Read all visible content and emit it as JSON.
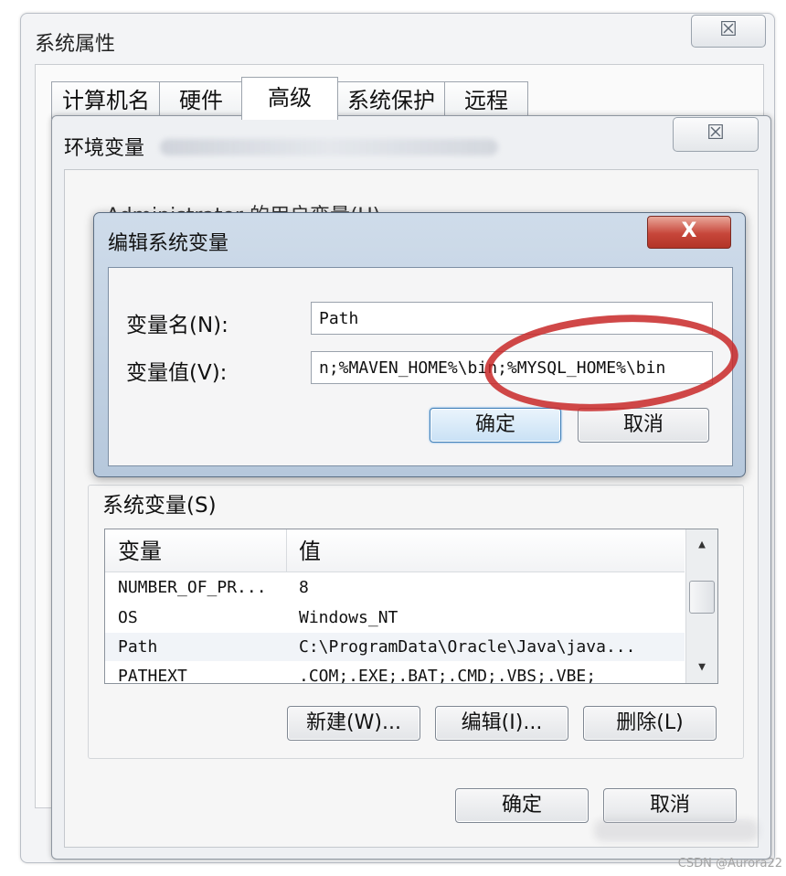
{
  "outer_window": {
    "title": "系统属性",
    "close_glyph": "☒",
    "tabs": [
      "计算机名",
      "硬件",
      "高级",
      "系统保护",
      "远程"
    ]
  },
  "env_window": {
    "title": "环境变量",
    "close_glyph": "☒",
    "user_group_caption": "Administrator 的用户变量(U)",
    "system_group_caption": "系统变量(S)",
    "columns": [
      "变量",
      "值"
    ],
    "rows": [
      {
        "name": "NUMBER_OF_PR...",
        "value": "8"
      },
      {
        "name": "OS",
        "value": "Windows_NT"
      },
      {
        "name": "Path",
        "value": "C:\\ProgramData\\Oracle\\Java\\java..."
      },
      {
        "name": "PATHEXT",
        "value": ".COM;.EXE;.BAT;.CMD;.VBS;.VBE;"
      }
    ],
    "buttons": {
      "new": "新建(W)...",
      "edit": "编辑(I)...",
      "delete": "删除(L)"
    },
    "ok": "确定",
    "cancel": "取消"
  },
  "edit_dialog": {
    "title": "编辑系统变量",
    "close_glyph": "X",
    "name_label": "变量名(N):",
    "value_label": "变量值(V):",
    "name_value": "Path",
    "value_value": "n;%MAVEN_HOME%\\bin;%MYSQL_HOME%\\bin",
    "ok": "确定",
    "cancel": "取消"
  },
  "colors": {
    "annotation": "#c82828",
    "selection_button_border": "#3f7fb8"
  },
  "watermark": "CSDN @Aurora22"
}
